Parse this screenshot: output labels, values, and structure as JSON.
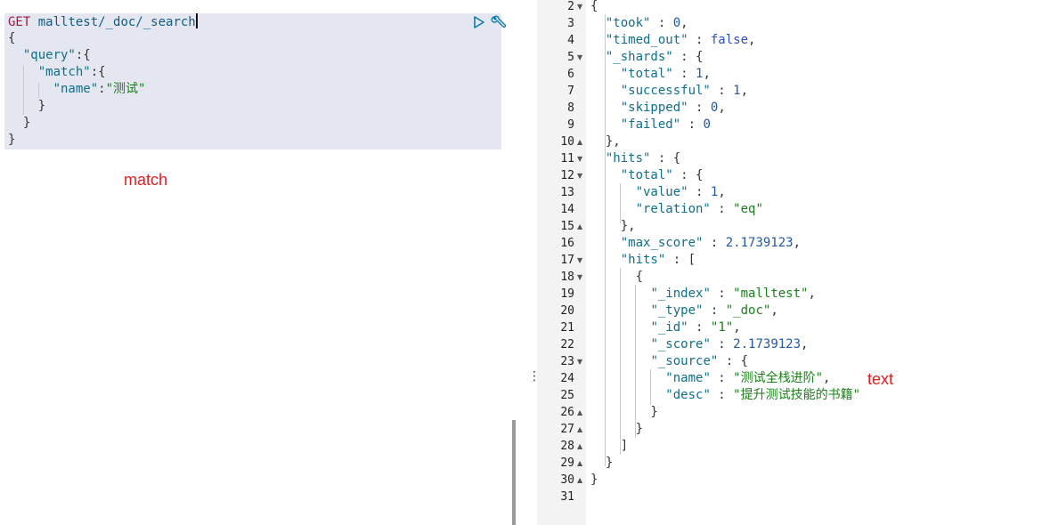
{
  "request": {
    "method": "GET",
    "url": "malltest/_doc/_search",
    "query_key": "\"query\"",
    "match_key": "\"match\"",
    "field_key": "\"name\"",
    "field_value": "\"测试\""
  },
  "annotations": {
    "match_label": "match",
    "text_label": "text"
  },
  "response": {
    "line_numbers": [
      "2",
      "3",
      "4",
      "5",
      "6",
      "7",
      "8",
      "9",
      "10",
      "11",
      "12",
      "13",
      "14",
      "15",
      "16",
      "17",
      "18",
      "19",
      "20",
      "21",
      "22",
      "23",
      "24",
      "25",
      "26",
      "27",
      "28",
      "29",
      "30",
      "31"
    ],
    "took_key": "\"took\"",
    "took_val": "0",
    "timed_out_key": "\"timed_out\"",
    "timed_out_val": "false",
    "shards_key": "\"_shards\"",
    "total_key": "\"total\"",
    "shards_total": "1",
    "successful_key": "\"successful\"",
    "successful_val": "1",
    "skipped_key": "\"skipped\"",
    "skipped_val": "0",
    "failed_key": "\"failed\"",
    "failed_val": "0",
    "hits_key": "\"hits\"",
    "value_key": "\"value\"",
    "value_val": "1",
    "relation_key": "\"relation\"",
    "relation_val": "\"eq\"",
    "max_score_key": "\"max_score\"",
    "max_score_val": "2.1739123",
    "index_key": "\"_index\"",
    "index_val": "\"malltest\"",
    "type_key": "\"_type\"",
    "type_val": "\"_doc\"",
    "id_key": "\"_id\"",
    "id_val": "\"1\"",
    "score_key": "\"_score\"",
    "score_val": "2.1739123",
    "source_key": "\"_source\"",
    "name_key": "\"name\"",
    "name_val": "\"测试全栈进阶\"",
    "desc_key": "\"desc\"",
    "desc_val": "\"提升测试技能的书籍\""
  }
}
